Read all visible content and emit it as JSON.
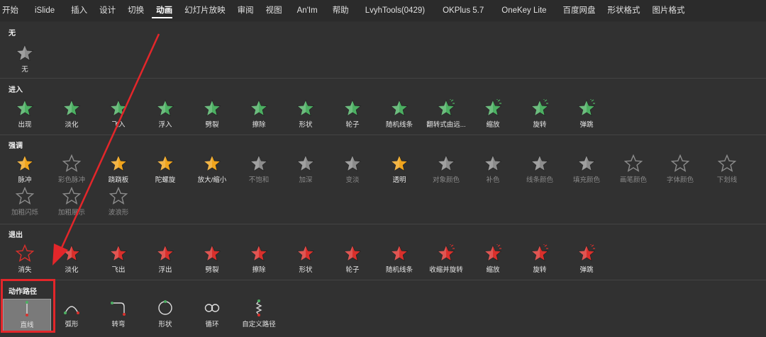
{
  "menubar": {
    "items": [
      "开始",
      "iSlide",
      "插入",
      "设计",
      "切换",
      "动画",
      "幻灯片放映",
      "审阅",
      "视图",
      "An'Im",
      "帮助",
      "LvyhTools(0429)",
      "OKPlus 5.7",
      "OneKey Lite",
      "百度网盘",
      "形状格式",
      "图片格式"
    ],
    "active": "动画"
  },
  "sections": {
    "none": {
      "title": "无",
      "items": [
        {
          "label": "无"
        }
      ]
    },
    "entrance": {
      "title": "进入",
      "items": [
        {
          "label": "出现"
        },
        {
          "label": "淡化"
        },
        {
          "label": "飞入"
        },
        {
          "label": "浮入"
        },
        {
          "label": "劈裂"
        },
        {
          "label": "擦除"
        },
        {
          "label": "形状"
        },
        {
          "label": "轮子"
        },
        {
          "label": "随机线条"
        },
        {
          "label": "翻转式由远..."
        },
        {
          "label": "缩放"
        },
        {
          "label": "旋转"
        },
        {
          "label": "弹跳"
        }
      ]
    },
    "emphasis": {
      "title": "强调",
      "items": [
        {
          "label": "脉冲"
        },
        {
          "label": "彩色脉冲"
        },
        {
          "label": "跷跷板"
        },
        {
          "label": "陀螺旋"
        },
        {
          "label": "放大/缩小"
        },
        {
          "label": "不饱和"
        },
        {
          "label": "加深"
        },
        {
          "label": "变淡"
        },
        {
          "label": "透明"
        },
        {
          "label": "对象颜色"
        },
        {
          "label": "补色"
        },
        {
          "label": "线条颜色"
        },
        {
          "label": "填充颜色"
        },
        {
          "label": "画笔颜色"
        },
        {
          "label": "字体颜色"
        },
        {
          "label": "下划线"
        },
        {
          "label": "加粗闪烁"
        },
        {
          "label": "加粗展示"
        },
        {
          "label": "波浪形"
        }
      ]
    },
    "exit": {
      "title": "退出",
      "items": [
        {
          "label": "消失"
        },
        {
          "label": "淡化"
        },
        {
          "label": "飞出"
        },
        {
          "label": "浮出"
        },
        {
          "label": "劈裂"
        },
        {
          "label": "擦除"
        },
        {
          "label": "形状"
        },
        {
          "label": "轮子"
        },
        {
          "label": "随机线条"
        },
        {
          "label": "收缩并旋转"
        },
        {
          "label": "缩放"
        },
        {
          "label": "旋转"
        },
        {
          "label": "弹跳"
        }
      ]
    },
    "motion": {
      "title": "动作路径",
      "items": [
        {
          "label": "直线"
        },
        {
          "label": "弧形"
        },
        {
          "label": "转弯"
        },
        {
          "label": "形状"
        },
        {
          "label": "循环"
        },
        {
          "label": "自定义路径"
        }
      ]
    }
  },
  "colors": {
    "green": "#4caf62",
    "gold": "#f0a51e",
    "red": "#d9302c",
    "gray": "#8c8c8c",
    "highlight": "#e3262a"
  }
}
